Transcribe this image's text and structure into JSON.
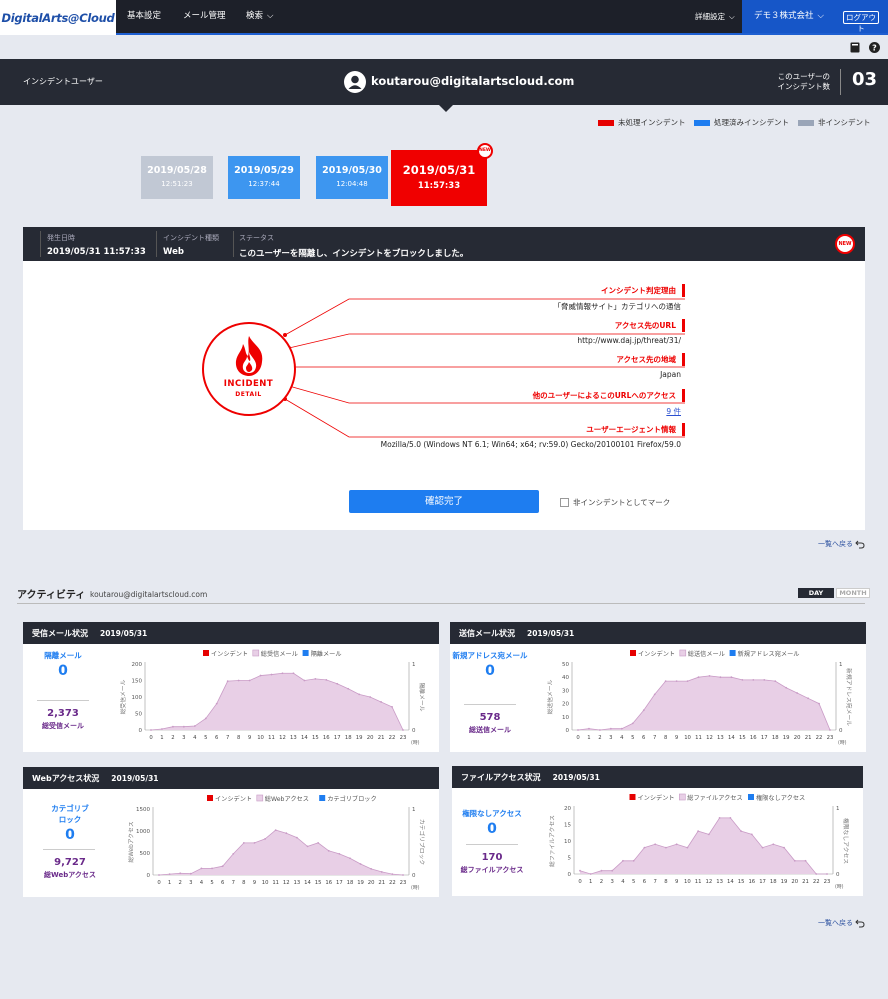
{
  "nav": {
    "logo": "DigitalArts@Cloud",
    "items": [
      "基本設定",
      "メール管理",
      "検索"
    ],
    "detail": "詳細設定",
    "company": "デモ３株式会社",
    "logout": "ログアウト"
  },
  "userbar": {
    "section": "インシデントユーザー",
    "email": "koutarou@digitalartscloud.com",
    "count_label1": "このユーザーの",
    "count_label2": "インシデント数",
    "count": "03"
  },
  "legend": [
    {
      "label": "未処理インシデント",
      "color": "#e60000"
    },
    {
      "label": "処理済みインシデント",
      "color": "#1e7df0"
    },
    {
      "label": "非インシデント",
      "color": "#9aa5b8"
    }
  ],
  "tiles": [
    {
      "date": "2019/05/28",
      "time": "12:51:23",
      "state": "non"
    },
    {
      "date": "2019/05/29",
      "time": "12:37:44",
      "state": "done"
    },
    {
      "date": "2019/05/30",
      "time": "12:04:48",
      "state": "done"
    },
    {
      "date": "2019/05/31",
      "time": "11:57:33",
      "state": "open",
      "badge": "NEW"
    }
  ],
  "detail": {
    "h_date_label": "発生日時",
    "h_date": "2019/05/31 11:57:33",
    "h_type_label": "インシデント種類",
    "h_type": "Web",
    "h_status_label": "ステータス",
    "h_status": "このユーザーを隔離し、インシデントをブロックしました。",
    "badge": "NEW",
    "logo_title": "INCIDENT",
    "logo_sub": "DETAIL",
    "rows": [
      {
        "label": "インシデント判定理由",
        "value": "「脅威情報サイト」カテゴリへの通信"
      },
      {
        "label": "アクセス先のURL",
        "value": "http://www.daj.jp/threat/31/"
      },
      {
        "label": "アクセス先の地域",
        "value": "Japan"
      },
      {
        "label": "他のユーザーによるこのURLへのアクセス",
        "value": "9 件"
      },
      {
        "label": "ユーザーエージェント情報",
        "value": "Mozilla/5.0 (Windows NT 6.1; Win64; x64; rv:59.0) Gecko/20100101 Firefox/59.0"
      }
    ],
    "confirm": "確認完了",
    "mark_false": "非インシデントとしてマーク"
  },
  "back": "一覧へ戻る",
  "activity": {
    "title": "アクティビティ",
    "email": "koutarou@digitalartscloud.com",
    "day": "DAY",
    "month": "MONTH"
  },
  "chart_data": [
    {
      "type": "area",
      "title": "受信メール状況",
      "date": "2019/05/31",
      "legend": [
        "インシデント",
        "総受信メール",
        "隔離メール"
      ],
      "ylabel": "総受信メール",
      "y2label": "隔離メール",
      "ylim": [
        0,
        200
      ],
      "yticks": [
        0,
        50,
        100,
        150,
        200
      ],
      "y2lim": [
        0,
        1
      ],
      "x": [
        0,
        1,
        2,
        3,
        4,
        5,
        6,
        7,
        8,
        9,
        10,
        11,
        12,
        13,
        14,
        15,
        16,
        17,
        18,
        19,
        20,
        21,
        22,
        23
      ],
      "xunit": "(時)",
      "values": [
        0,
        3,
        10,
        10,
        12,
        35,
        80,
        148,
        150,
        150,
        165,
        168,
        172,
        172,
        150,
        155,
        152,
        140,
        125,
        108,
        100,
        85,
        70,
        0
      ],
      "stat1_label": "隔離メール",
      "stat1_value": "0",
      "stat2_value": "2,373",
      "stat2_label": "総受信メール"
    },
    {
      "type": "area",
      "title": "送信メール状況",
      "date": "2019/05/31",
      "legend": [
        "インシデント",
        "総送信メール",
        "新規アドレス宛メール"
      ],
      "ylabel": "総送信メール",
      "y2label": "新規アドレス宛メール",
      "ylim": [
        0,
        50
      ],
      "yticks": [
        0,
        10,
        20,
        30,
        40,
        50
      ],
      "y2lim": [
        0,
        1
      ],
      "x": [
        0,
        1,
        2,
        3,
        4,
        5,
        6,
        7,
        8,
        9,
        10,
        11,
        12,
        13,
        14,
        15,
        16,
        17,
        18,
        19,
        20,
        21,
        22,
        23
      ],
      "xunit": "(時)",
      "values": [
        0,
        1,
        0,
        1,
        1,
        5,
        15,
        27,
        37,
        37,
        37,
        40,
        41,
        40,
        40,
        38,
        38,
        38,
        37,
        32,
        28,
        24,
        20,
        0
      ],
      "stat1_label": "新規アドレス宛メール",
      "stat1_value": "0",
      "stat2_value": "578",
      "stat2_label": "総送信メール"
    },
    {
      "type": "area",
      "title": "Webアクセス状況",
      "date": "2019/05/31",
      "legend": [
        "インシデント",
        "総Webアクセス",
        "カテゴリブロック"
      ],
      "ylabel": "総Webアクセス",
      "y2label": "カテゴリブロック",
      "ylim": [
        0,
        1500
      ],
      "yticks": [
        0,
        500,
        1000,
        1500
      ],
      "y2lim": [
        0,
        1
      ],
      "x": [
        0,
        1,
        2,
        3,
        4,
        5,
        6,
        7,
        8,
        9,
        10,
        11,
        12,
        13,
        14,
        15,
        16,
        17,
        18,
        19,
        20,
        21,
        22,
        23
      ],
      "xunit": "(時)",
      "values": [
        0,
        20,
        40,
        30,
        150,
        150,
        200,
        480,
        730,
        730,
        820,
        1020,
        950,
        850,
        650,
        730,
        550,
        480,
        380,
        250,
        140,
        70,
        20,
        0
      ],
      "stat1_label": "カテゴリブロック",
      "stat1_value": "0",
      "stat2_value": "9,727",
      "stat2_label": "総Webアクセス"
    },
    {
      "type": "area",
      "title": "ファイルアクセス状況",
      "date": "2019/05/31",
      "legend": [
        "インシデント",
        "総ファイルアクセス",
        "権限なしアクセス"
      ],
      "ylabel": "総ファイルアクセス",
      "y2label": "権限なしアクセス",
      "ylim": [
        0,
        20
      ],
      "yticks": [
        0,
        5,
        10,
        15,
        20
      ],
      "y2lim": [
        0,
        1
      ],
      "x": [
        0,
        1,
        2,
        3,
        4,
        5,
        6,
        7,
        8,
        9,
        10,
        11,
        12,
        13,
        14,
        15,
        16,
        17,
        18,
        19,
        20,
        21,
        22,
        23
      ],
      "xunit": "(時)",
      "values": [
        1,
        0,
        1,
        1,
        4,
        4,
        8,
        9,
        8,
        9,
        8,
        13,
        12,
        17,
        17,
        13,
        12,
        8,
        9,
        8,
        4,
        4,
        0,
        0
      ],
      "stat1_label": "権限なしアクセス",
      "stat1_value": "0",
      "stat2_value": "170",
      "stat2_label": "総ファイルアクセス"
    }
  ],
  "icons": {
    "book": "book-icon",
    "help": "help-icon",
    "user": "user-icon",
    "back": "back-arrow-icon",
    "chevron": "chevron-down-icon"
  },
  "colors": {
    "accent": "#1e7df0",
    "open": "#e60000",
    "nav": "#1d2029",
    "area": "#e8cfe6",
    "areaLine": "#c99bc6"
  }
}
